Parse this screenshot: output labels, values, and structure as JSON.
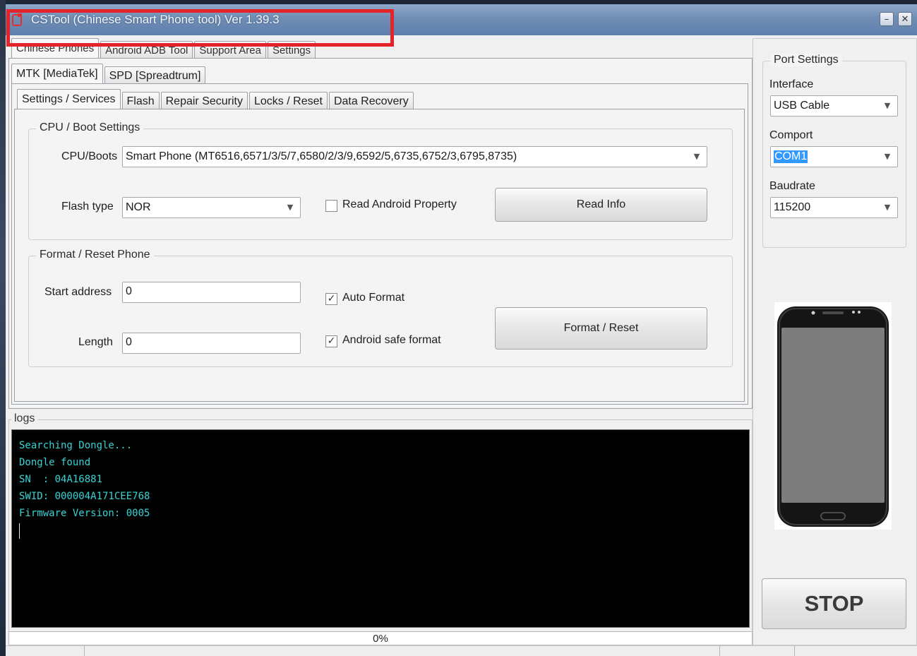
{
  "window": {
    "title": "CSTool (Chinese Smart Phone tool)  Ver 1.39.3",
    "minimize_glyph": "–",
    "close_glyph": "✕"
  },
  "main_tabs": [
    {
      "label": "Chinese Phones"
    },
    {
      "label": "Android ADB Tool"
    },
    {
      "label": "Support Area"
    },
    {
      "label": "Settings"
    }
  ],
  "vendor_tabs": [
    {
      "label": "MTK [MediaTek]"
    },
    {
      "label": "SPD [Spreadtrum]"
    }
  ],
  "function_tabs": [
    {
      "label": "Settings / Services"
    },
    {
      "label": "Flash"
    },
    {
      "label": "Repair Security"
    },
    {
      "label": "Locks / Reset"
    },
    {
      "label": "Data Recovery"
    }
  ],
  "cpu_boot": {
    "group_title": "CPU / Boot Settings",
    "cpu_label": "CPU/Boots",
    "cpu_value": "Smart Phone (MT6516,6571/3/5/7,6580/2/3/9,6592/5,6735,6752/3,6795,8735)",
    "flash_type_label": "Flash type",
    "flash_type_value": "NOR",
    "read_android_property_label": "Read Android Property",
    "read_android_property_checked": false,
    "read_info_button": "Read Info"
  },
  "format_reset": {
    "group_title": "Format / Reset Phone",
    "start_address_label": "Start address",
    "start_address_value": "0",
    "length_label": "Length",
    "length_value": "0",
    "auto_format_label": "Auto Format",
    "auto_format_checked": true,
    "android_safe_format_label": "Android safe format",
    "android_safe_format_checked": true,
    "format_reset_button": "Format  / Reset"
  },
  "logs": {
    "title": "logs",
    "lines": [
      "Searching Dongle...",
      "Dongle found",
      "SN  : 04A16881",
      "SWID: 000004A171CEE768",
      "Firmware Version: 0005"
    ]
  },
  "progress": {
    "value": 0,
    "text": "0%"
  },
  "port_settings": {
    "group_title": "Port Settings",
    "interface_label": "Interface",
    "interface_value": "USB Cable",
    "comport_label": "Comport",
    "comport_value": "COM1",
    "baudrate_label": "Baudrate",
    "baudrate_value": "115200"
  },
  "stop_button": "STOP",
  "icons": {
    "app": "app-icon",
    "dropdown": "chevron-down-icon",
    "check": "checkmark-icon",
    "phone": "smartphone-illustration"
  },
  "colors": {
    "title_bar": "#6f8db4",
    "highlight_box": "#e3242b",
    "log_text": "#35d4d4",
    "log_background": "#000000",
    "comport_selection": "#3399ff"
  }
}
